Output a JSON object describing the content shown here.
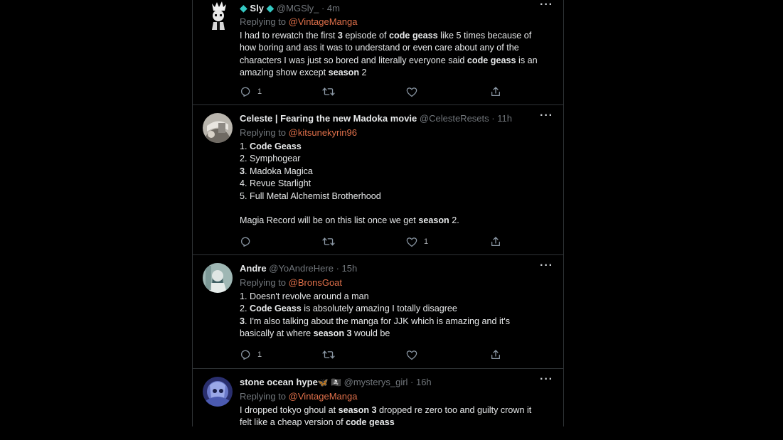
{
  "tweets": [
    {
      "name": "Sly",
      "handle": "@MGSly_ · 4m",
      "reply_prefix": "Replying to",
      "reply_to": "@VintageManga",
      "lines": [
        [
          {
            "t": "I had to rewatch the first "
          },
          {
            "t": "3",
            "b": true
          },
          {
            "t": " episode of "
          },
          {
            "t": "code geass",
            "b": true
          },
          {
            "t": " like 5 times because of"
          }
        ],
        [
          {
            "t": "how boring and ass it was to understand or even care about any of the"
          }
        ],
        [
          {
            "t": "characters I was just so bored and literally everyone said "
          },
          {
            "t": "code geass",
            "b": true
          },
          {
            "t": " is an"
          }
        ],
        [
          {
            "t": "amazing show except "
          },
          {
            "t": "season",
            "b": true
          },
          {
            "t": " 2"
          }
        ]
      ],
      "reply_count": "1",
      "retweet_count": "",
      "like_count": ""
    },
    {
      "name": "Celeste | Fearing the new Madoka movie",
      "handle": "@CelesteResets · 11h",
      "reply_prefix": "Replying to",
      "reply_to": "@kitsunekyrin96",
      "lines": [
        [
          {
            "t": "1. "
          },
          {
            "t": "Code Geass",
            "b": true
          }
        ],
        [
          {
            "t": "2. Symphogear"
          }
        ],
        [
          {
            "t": "3",
            "b": true
          },
          {
            "t": ". Madoka Magica"
          }
        ],
        [
          {
            "t": "4. Revue Starlight"
          }
        ],
        [
          {
            "t": "5. Full Metal Alchemist Brotherhood"
          }
        ],
        [
          {
            "t": ""
          }
        ],
        [
          {
            "t": "Magia Record will be on this list once we get "
          },
          {
            "t": "season",
            "b": true
          },
          {
            "t": " 2."
          }
        ]
      ],
      "reply_count": "",
      "retweet_count": "",
      "like_count": "1"
    },
    {
      "name": "Andre",
      "handle": "@YoAndreHere · 15h",
      "reply_prefix": "Replying to",
      "reply_to": "@BronsGoat",
      "lines": [
        [
          {
            "t": "1. Doesn't revolve around a man"
          }
        ],
        [
          {
            "t": "2. "
          },
          {
            "t": "Code Geass",
            "b": true
          },
          {
            "t": " is absolutely amazing I totally disagree"
          }
        ],
        [
          {
            "t": "3",
            "b": true
          },
          {
            "t": ". I'm also talking about the manga for JJK which is amazing and it's"
          }
        ],
        [
          {
            "t": "basically at where "
          },
          {
            "t": "season 3",
            "b": true
          },
          {
            "t": " would be"
          }
        ]
      ],
      "reply_count": "1",
      "retweet_count": "",
      "like_count": ""
    },
    {
      "name": "stone ocean hype",
      "name_emoji": "🦋 🏴‍☠️",
      "handle": "@mysterys_girl · 16h",
      "reply_prefix": "Replying to",
      "reply_to": "@VintageManga",
      "lines": [
        [
          {
            "t": "I dropped tokyo ghoul at "
          },
          {
            "t": "season 3",
            "b": true
          },
          {
            "t": " dropped re zero too and guilty crown it"
          }
        ],
        [
          {
            "t": "felt like a cheap version of "
          },
          {
            "t": "code geass",
            "b": true
          }
        ]
      ],
      "reply_count": "",
      "retweet_count": "",
      "like_count": ""
    }
  ],
  "more_label": "···",
  "verified_glyph": "◆",
  "colors": {
    "background": "#000000",
    "link": "#e0704a",
    "muted": "#71767b",
    "text": "#e7e9ea",
    "border": "#2f3336",
    "diamond": "#34c9c3"
  },
  "icons": {
    "reply": "reply-icon",
    "retweet": "retweet-icon",
    "like": "like-icon",
    "share": "share-icon",
    "more": "more-icon"
  }
}
